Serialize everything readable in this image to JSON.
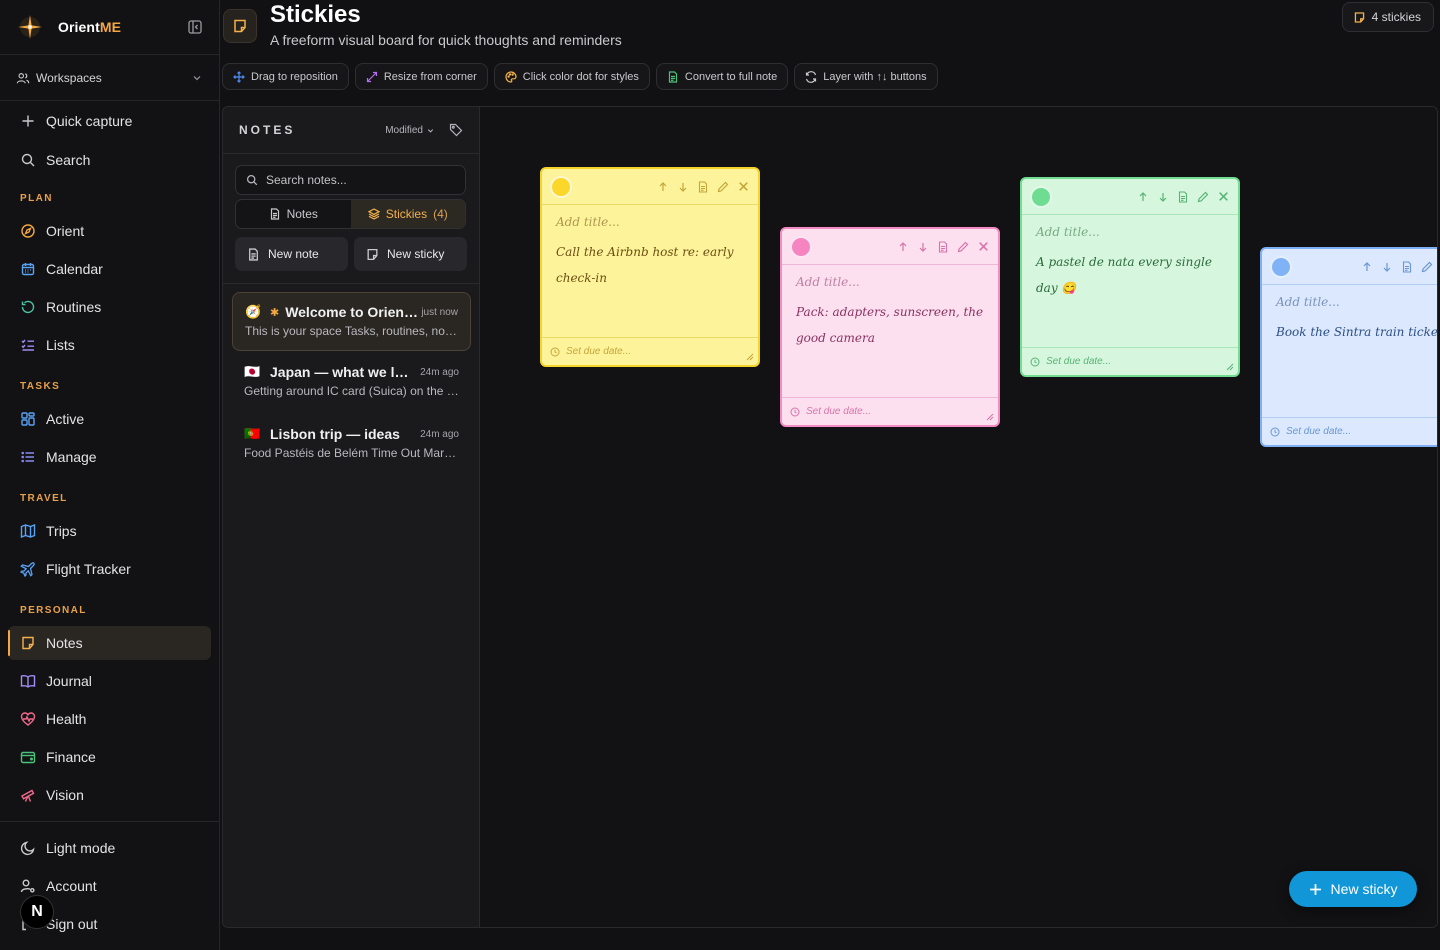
{
  "brand": {
    "name_plain": "Orient",
    "name_accent": "ME"
  },
  "sidebar": {
    "workspaces_label": "Workspaces",
    "top_items": [
      {
        "label": "Quick capture",
        "icon": "plus-icon"
      },
      {
        "label": "Search",
        "icon": "search-icon"
      }
    ],
    "sections": [
      {
        "label": "PLAN",
        "items": [
          {
            "label": "Orient",
            "icon": "compass-icon"
          },
          {
            "label": "Calendar",
            "icon": "calendar-icon"
          },
          {
            "label": "Routines",
            "icon": "refresh-icon"
          },
          {
            "label": "Lists",
            "icon": "checklist-icon"
          }
        ]
      },
      {
        "label": "TASKS",
        "items": [
          {
            "label": "Active",
            "icon": "grid-icon"
          },
          {
            "label": "Manage",
            "icon": "list-icon"
          }
        ]
      },
      {
        "label": "TRAVEL",
        "items": [
          {
            "label": "Trips",
            "icon": "map-icon"
          },
          {
            "label": "Flight Tracker",
            "icon": "plane-icon"
          }
        ]
      },
      {
        "label": "PERSONAL",
        "items": [
          {
            "label": "Notes",
            "icon": "sticky-note-icon",
            "active": true
          },
          {
            "label": "Journal",
            "icon": "book-icon"
          },
          {
            "label": "Health",
            "icon": "heart-pulse-icon"
          },
          {
            "label": "Finance",
            "icon": "wallet-icon"
          },
          {
            "label": "Vision",
            "icon": "telescope-icon"
          }
        ]
      }
    ],
    "bottom_items": [
      {
        "label": "Light mode",
        "icon": "moon-icon"
      },
      {
        "label": "Account",
        "icon": "user-cog-icon"
      },
      {
        "label": "Sign out",
        "icon": "logout-icon"
      }
    ],
    "next_badge": "N"
  },
  "header": {
    "title": "Stickies",
    "subtitle": "A freeform visual board for quick thoughts and reminders",
    "count_badge": "4 stickies"
  },
  "hints": [
    {
      "label": "Drag to reposition",
      "icon": "move-icon",
      "color": "#4f8ef7"
    },
    {
      "label": "Resize from corner",
      "icon": "resize-icon",
      "color": "#b46cf0"
    },
    {
      "label": "Click color dot for styles",
      "icon": "palette-icon",
      "color": "#f4b24a"
    },
    {
      "label": "Convert to full note",
      "icon": "document-icon",
      "color": "#4cc37a"
    },
    {
      "label": "Layer with ↑↓ buttons",
      "icon": "layers-icon",
      "color": "#c9c9ce"
    }
  ],
  "notes_pane": {
    "title": "NOTES",
    "sort_label": "Modified",
    "search_placeholder": "Search notes...",
    "tabs": [
      {
        "label": "Notes",
        "count": ""
      },
      {
        "label": "Stickies",
        "count": "(4)",
        "active": true
      }
    ],
    "new_note_label": "New note",
    "new_sticky_label": "New sticky",
    "notes": [
      {
        "emoji": "🧭",
        "pinned": true,
        "title": "Welcome to OrientME",
        "time": "just now",
        "preview": "This is your space Tasks, routines, notes and more",
        "selected": true
      },
      {
        "emoji": "🇯🇵",
        "pinned": false,
        "title": "Japan — what we learned",
        "time": "24m ago",
        "preview": "Getting around IC card (Suica) on the trains and buses"
      },
      {
        "emoji": "🇵🇹",
        "pinned": false,
        "title": "Lisbon trip — ideas",
        "time": "24m ago",
        "preview": "Food Pastéis de Belém Time Out Market Alfama"
      }
    ]
  },
  "stickies": [
    {
      "color": "yellow",
      "title_placeholder": "Add title...",
      "text": "Call the Airbnb host re: early check-in",
      "due_placeholder": "Set due date..."
    },
    {
      "color": "pink",
      "title_placeholder": "Add title...",
      "text": "Pack: adapters, sunscreen, the good camera",
      "due_placeholder": "Set due date..."
    },
    {
      "color": "green",
      "title_placeholder": "Add title...",
      "text": "A pastel de nata every single day 😋",
      "due_placeholder": "Set due date..."
    },
    {
      "color": "blue",
      "title_placeholder": "Add title...",
      "text": "Book the Sintra train tickets",
      "due_placeholder": "Set due date..."
    }
  ],
  "fab_label": "New sticky",
  "colors": {
    "accent": "#f4a742",
    "fab": "#1197d8"
  }
}
